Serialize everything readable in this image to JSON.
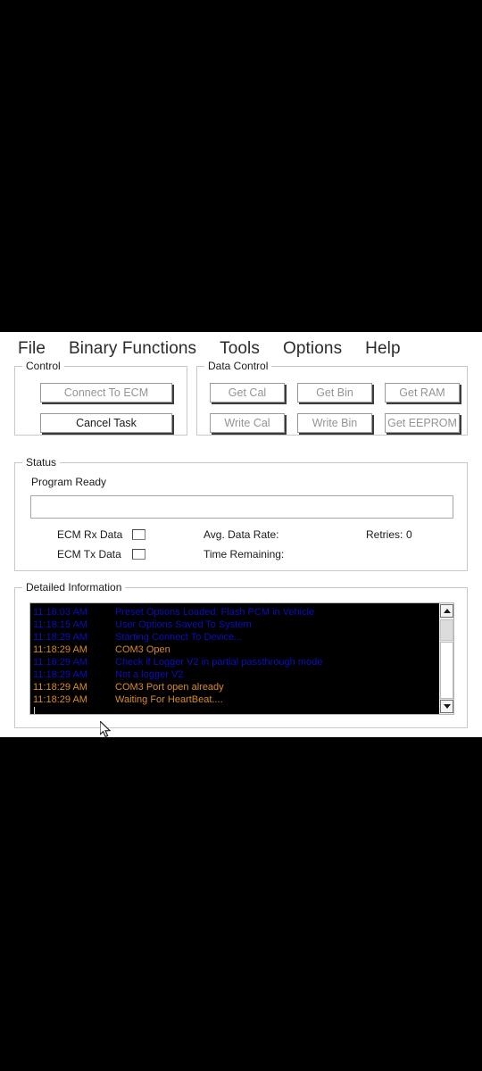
{
  "menubar": {
    "items": [
      {
        "label": "File",
        "name": "menu-file"
      },
      {
        "label": "Binary Functions",
        "name": "menu-binary-functions"
      },
      {
        "label": "Tools",
        "name": "menu-tools"
      },
      {
        "label": "Options",
        "name": "menu-options"
      },
      {
        "label": "Help",
        "name": "menu-help"
      }
    ]
  },
  "control_group": {
    "title": "Control",
    "connect_button": "Connect To ECM",
    "cancel_button": "Cancel Task"
  },
  "data_control_group": {
    "title": "Data Control",
    "get_cal": "Get Cal",
    "get_bin": "Get Bin",
    "get_ram": "Get RAM",
    "write_cal": "Write Cal",
    "write_bin": "Write Bin",
    "get_eeprom": "Get EEPROM"
  },
  "status_group": {
    "title": "Status",
    "program_state": "Program Ready",
    "progress_value": "",
    "ecm_rx_label": "ECM Rx Data",
    "ecm_tx_label": "ECM Tx Data",
    "avg_data_rate_label": "Avg. Data Rate:",
    "avg_data_rate_value": "",
    "time_remaining_label": "Time Remaining:",
    "time_remaining_value": "",
    "retries_label": "Retries:",
    "retries_value": "0"
  },
  "detailed_information": {
    "title": "Detailed Information",
    "lines": [
      {
        "time": "11:18:03 AM",
        "message": "Preset Options Loaded: Flash PCM in Vehicle",
        "color": "blue"
      },
      {
        "time": "11:18:15 AM",
        "message": "User Options Saved To System",
        "color": "blue"
      },
      {
        "time": "11:18:29 AM",
        "message": "Starting Connect To Device...",
        "color": "blue"
      },
      {
        "time": "11:18:29 AM",
        "message": "COM3 Open",
        "color": "amber"
      },
      {
        "time": "11:18:29 AM",
        "message": "Check if Logger V2 in partial passthrough mode",
        "color": "blue"
      },
      {
        "time": "11:18:29 AM",
        "message": "Not a logger V2",
        "color": "blue"
      },
      {
        "time": "11:18:29 AM",
        "message": "COM3 Port open already",
        "color": "amber"
      },
      {
        "time": "11:18:29 AM",
        "message": "Waiting For HeartBeat....",
        "color": "amber"
      }
    ]
  },
  "colors": {
    "log_background": "#000000",
    "log_blue": "#0d0dbe",
    "log_amber": "#d98b20",
    "window_background": "#ffffff",
    "letterbox": "#000000",
    "group_border": "#c8c8c8"
  }
}
